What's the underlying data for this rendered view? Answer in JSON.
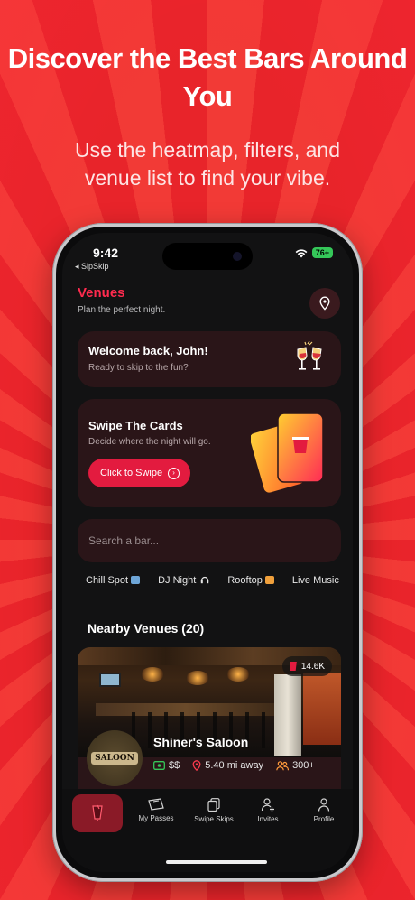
{
  "promo": {
    "headline": "Discover the Best Bars Around You",
    "subline": "Use the heatmap, filters, and venue list to find your vibe."
  },
  "status_bar": {
    "time": "9:42",
    "back_label": "◂ SipSkip",
    "battery": "76+"
  },
  "header": {
    "title": "Venues",
    "subtitle": "Plan the perfect night."
  },
  "welcome_card": {
    "title": "Welcome back, John!",
    "subtitle": "Ready to skip to the fun?"
  },
  "swipe_card": {
    "title": "Swipe The Cards",
    "subtitle": "Decide where the night will go.",
    "button_label": "Click to Swipe"
  },
  "search": {
    "placeholder": "Search a bar..."
  },
  "filters": [
    {
      "label": "Chill Spot",
      "color": "#6ea6d8"
    },
    {
      "label": "DJ Night",
      "icon": "headphones-icon"
    },
    {
      "label": "Rooftop",
      "color": "#f0a03c"
    },
    {
      "label": "Live Music"
    }
  ],
  "nearby": {
    "title": "Nearby Venues (20)"
  },
  "venue": {
    "name": "Shiner's Saloon",
    "badge_count": "14.6K",
    "price": "$$",
    "distance": "5.40 mi away",
    "crowd": "300+",
    "logo_text": "SALOON"
  },
  "tabs": [
    {
      "label": ""
    },
    {
      "label": "My Passes"
    },
    {
      "label": "Swipe Skips"
    },
    {
      "label": "Invites"
    },
    {
      "label": "Profile"
    }
  ],
  "colors": {
    "accent": "#e31b3f",
    "title_red": "#ff2b4e",
    "card_bg": "#2a1518",
    "screen_bg": "#121213"
  }
}
